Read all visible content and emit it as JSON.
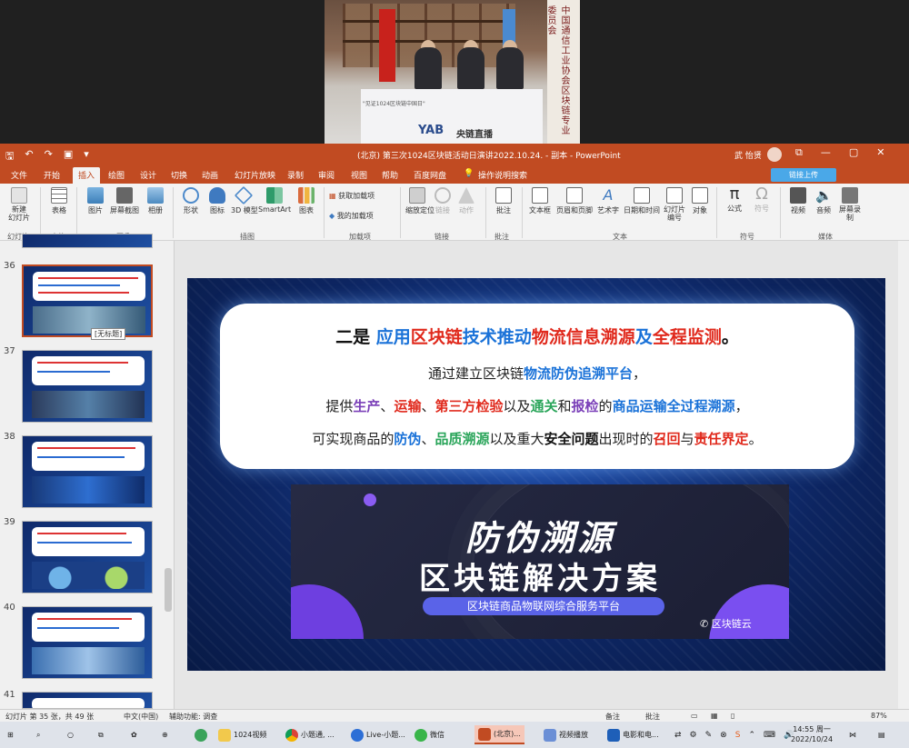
{
  "video": {
    "side_banner": "中国通信工业协会区块链专业委员会",
    "desk_banner": "\"见证1024区块链中国日\"",
    "logo": "YAB",
    "channel": "央链直播"
  },
  "app": {
    "title": "(北京) 第三次1024区块链活动日演讲2022.10.24. - 副本 - PowerPoint",
    "user": "武 怡贤",
    "share": "链接上传",
    "win_buttons": [
      "⧉",
      "—",
      "▢",
      "✕"
    ]
  },
  "tabs": [
    "文件",
    "开始",
    "插入",
    "绘图",
    "设计",
    "切换",
    "动画",
    "幻灯片放映",
    "录制",
    "审阅",
    "视图",
    "帮助",
    "百度网盘"
  ],
  "tab_search": "操作说明搜索",
  "ribbon": {
    "new_slide": "新建\n幻灯片",
    "table": "表格",
    "picture": "图片",
    "screenshot": "屏幕截图",
    "album": "相册",
    "shapes": "形状",
    "icons": "图标",
    "model3d": "3D 模型",
    "smartart": "SmartArt",
    "chart": "图表",
    "get_addins": "获取加载项",
    "my_addins": "我的加载项",
    "zoom": "缩放定位",
    "link": "链接",
    "action": "动作",
    "comment": "批注",
    "textbox": "文本框",
    "header_footer": "页眉和页脚",
    "wordart": "艺术字",
    "datetime": "日期和时间",
    "slide_number": "幻灯片编号",
    "object": "对象",
    "equation": "公式",
    "symbol": "符号",
    "video": "视频",
    "audio": "音频",
    "screen_record": "屏幕录制",
    "groups": [
      "幻灯片",
      "表格",
      "图像",
      "插图",
      "加载项",
      "链接",
      "批注",
      "文本",
      "符号",
      "媒体"
    ]
  },
  "thumbnails": {
    "numbers": [
      "36",
      "37",
      "38",
      "39",
      "40",
      "41"
    ],
    "tooltip": "[无标题]"
  },
  "slide": {
    "title_prefix": "二是 ",
    "title_parts": [
      "应用",
      "区块链",
      "技术推动",
      "物流信息溯源",
      "及",
      "全程监测",
      "。"
    ],
    "line1_a": "通过建立区块链",
    "line1_b": "物流防伪追溯平台",
    "line1_c": "，",
    "line2": [
      "提供",
      "生产",
      "、",
      "运输",
      "、",
      "第三方检验",
      "以及",
      "通关",
      "和",
      "报检",
      "的",
      "商品运输全过程溯源",
      "，"
    ],
    "line3": [
      "可实现商品的",
      "防伪",
      "、",
      "品质溯源",
      "以及重大",
      "安全问题",
      "出现时的",
      "召回",
      "与",
      "责任界定",
      "。"
    ],
    "promo_title1": "防伪溯源",
    "promo_title2": "区块链解决方案",
    "promo_pill": "区块链商品物联网综合服务平台",
    "promo_brand": "区块链云"
  },
  "status": {
    "slide_count": "幻灯片 第 35 张，共 49 张",
    "language": "中文(中国)",
    "accessibility": "辅助功能: 调查",
    "notes": "备注",
    "comments": "批注",
    "zoom": "87%"
  },
  "taskbar": {
    "items": [
      "1024视频",
      "小题通, ...",
      "Live-小题...",
      "微信",
      "(北京)...",
      "视频播放",
      "电影和电..."
    ],
    "time": "14:55 周一",
    "date": "2022/10/24"
  },
  "colors": {
    "accent": "#c14b22",
    "highlight_red": "#e0291c",
    "highlight_blue": "#1a72d8",
    "highlight_green": "#2aa55a",
    "highlight_purple": "#7a3fb8"
  }
}
